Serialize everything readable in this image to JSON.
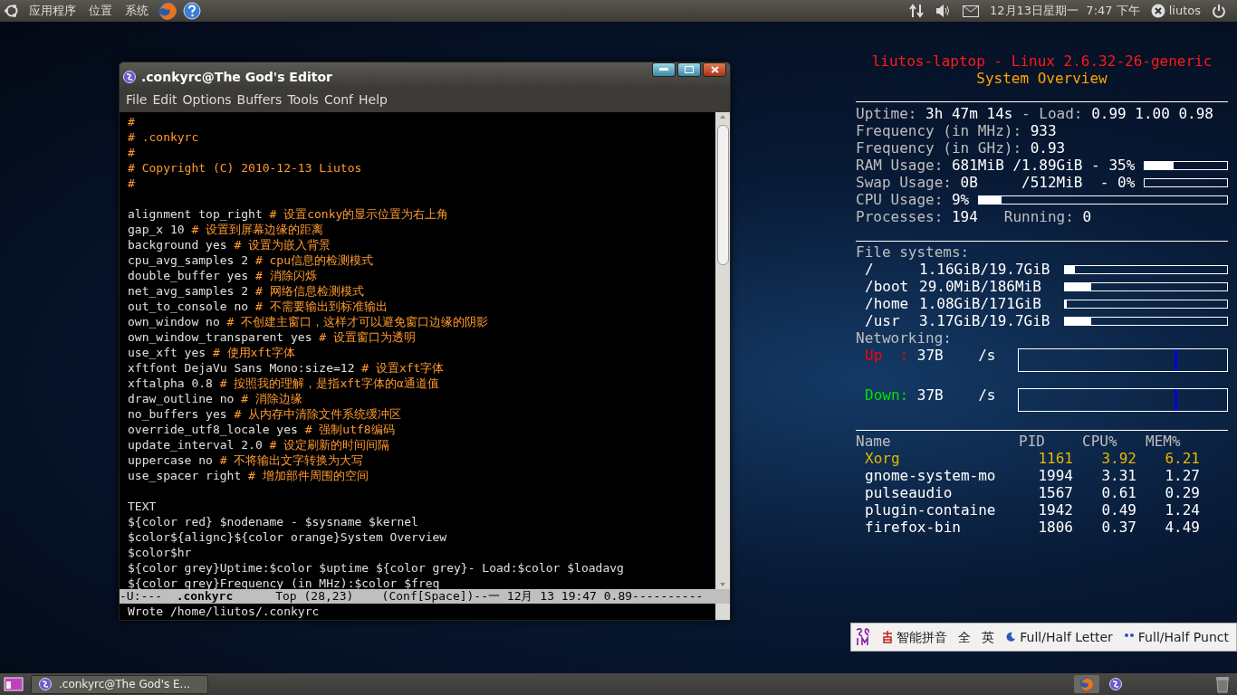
{
  "top_panel": {
    "menus": [
      {
        "label": "应用程序"
      },
      {
        "label": "位置"
      },
      {
        "label": "系统"
      }
    ],
    "clock": "12月13日星期一  7:47 下午",
    "user": "liutos"
  },
  "editor": {
    "title": ".conkyrc@The God's Editor",
    "menu": [
      {
        "label": "File"
      },
      {
        "label": "Edit"
      },
      {
        "label": "Options"
      },
      {
        "label": "Buffers"
      },
      {
        "label": "Tools"
      },
      {
        "label": "Conf"
      },
      {
        "label": "Help"
      }
    ],
    "lines": [
      {
        "kind": "comment",
        "text": "#"
      },
      {
        "kind": "comment",
        "text": "# .conkyrc"
      },
      {
        "kind": "comment",
        "text": "#"
      },
      {
        "kind": "comment",
        "text": "# Copyright (C) 2010-12-13 Liutos"
      },
      {
        "kind": "comment",
        "text": "#"
      },
      {
        "kind": "blank"
      },
      {
        "kind": "setting",
        "code": "alignment top_right",
        "comment": "# 设置conky的显示位置为右上角"
      },
      {
        "kind": "setting",
        "code": "gap_x 10",
        "comment": "# 设置到屏幕边缘的距离"
      },
      {
        "kind": "setting",
        "code": "background yes",
        "comment": "# 设置为嵌入背景"
      },
      {
        "kind": "setting",
        "code": "cpu_avg_samples 2",
        "comment": "# cpu信息的检测模式"
      },
      {
        "kind": "setting",
        "code": "double_buffer yes",
        "comment": "# 消除闪烁"
      },
      {
        "kind": "setting",
        "code": "net_avg_samples 2",
        "comment": "# 网络信息检测模式"
      },
      {
        "kind": "setting",
        "code": "out_to_console no",
        "comment": "# 不需要输出到标准输出"
      },
      {
        "kind": "setting",
        "code": "own_window no",
        "comment": "# 不创建主窗口，这样才可以避免窗口边缘的阴影"
      },
      {
        "kind": "setting",
        "code": "own_window_transparent yes",
        "comment": "# 设置窗口为透明"
      },
      {
        "kind": "setting",
        "code": "use_xft yes",
        "comment": "# 使用xft字体"
      },
      {
        "kind": "setting",
        "code": "xftfont DejaVu Sans Mono:size=12",
        "comment": "# 设置xft字体"
      },
      {
        "kind": "setting",
        "code": "xftalpha 0.8",
        "comment": "# 按照我的理解，是指xft字体的α通道值"
      },
      {
        "kind": "setting",
        "code": "draw_outline no",
        "comment": "# 消除边缘"
      },
      {
        "kind": "setting",
        "code": "no_buffers yes",
        "comment": "# 从内存中清除文件系统缓冲区"
      },
      {
        "kind": "setting",
        "code": "override_utf8_locale yes",
        "comment": "# 强制utf8编码"
      },
      {
        "kind": "setting",
        "code": "update_interval 2.0",
        "comment": "# 设定刷新的时间间隔"
      },
      {
        "kind": "setting",
        "code": "uppercase no",
        "comment": "# 不将输出文字转换为大写"
      },
      {
        "kind": "setting",
        "code": "use_spacer right",
        "comment": "# 增加部件周围的空间"
      },
      {
        "kind": "blank"
      },
      {
        "kind": "plain",
        "text": "TEXT"
      },
      {
        "kind": "plain",
        "text": "${color red} $nodename - $sysname $kernel"
      },
      {
        "kind": "plain",
        "text": "$color${alignc}${color orange}System Overview"
      },
      {
        "kind": "plain",
        "text": "$color$hr"
      },
      {
        "kind": "plain",
        "text": "${color grey}Uptime:$color $uptime ${color grey}- Load:$color $loadavg"
      },
      {
        "kind": "plain",
        "text": "${color grey}Frequency (in MHz):$color $freq"
      }
    ],
    "modeline": {
      "state": "-U:---",
      "buffer": ".conkyrc",
      "rest": "Top (28,23)    (Conf[Space])--一 12月 13 19:47 0.89----------"
    },
    "minibuffer": "Wrote /home/liutos/.conkyrc"
  },
  "conky": {
    "title": "liutos-laptop - Linux 2.6.32-26-generic",
    "subtitle": "System Overview",
    "stats": [
      {
        "parts": [
          {
            "text": "Uptime:",
            "kind": "label"
          },
          {
            "text": "3h 47m 14s",
            "kind": "value"
          },
          {
            "text": "- Load:",
            "kind": "label"
          },
          {
            "text": "0.99 1.00 0.98",
            "kind": "value"
          }
        ]
      },
      {
        "parts": [
          {
            "text": "Frequency (in MHz):",
            "kind": "label"
          },
          {
            "text": "933",
            "kind": "value"
          }
        ]
      },
      {
        "parts": [
          {
            "text": "Frequency (in GHz):",
            "kind": "label"
          },
          {
            "text": "0.93",
            "kind": "value"
          }
        ]
      },
      {
        "parts": [
          {
            "text": "RAM Usage:",
            "kind": "label"
          },
          {
            "text": "681MiB /1.89GiB",
            "kind": "value"
          },
          {
            "text": "- 35%",
            "kind": "value"
          }
        ],
        "meter": true,
        "level": 0.35
      },
      {
        "parts": [
          {
            "text": "Swap Usage:",
            "kind": "label"
          },
          {
            "text": "0B     /512MiB ",
            "kind": "value"
          },
          {
            "text": "- 0%",
            "kind": "value"
          }
        ],
        "meter": true
      },
      {
        "parts": [
          {
            "text": "CPU Usage:",
            "kind": "label"
          },
          {
            "text": "9%",
            "kind": "value"
          }
        ],
        "meter": true,
        "level": 0.09
      },
      {
        "parts": [
          {
            "text": "Processes:",
            "kind": "label"
          },
          {
            "text": "194  ",
            "kind": "value"
          },
          {
            "text": "Running:",
            "kind": "label"
          },
          {
            "text": "0",
            "kind": "value"
          }
        ]
      }
    ],
    "fs_heading": "File systems:",
    "filesystems": [
      {
        "mount": "/",
        "usage": "1.16GiB/19.7GiB",
        "level": 0.06
      },
      {
        "mount": "/boot",
        "usage": "29.0MiB/186MiB",
        "level": 0.16
      },
      {
        "mount": "/home",
        "usage": "1.08GiB/171GiB",
        "level": 0.01
      },
      {
        "mount": "/usr",
        "usage": "3.17GiB/19.7GiB",
        "level": 0.16
      }
    ],
    "net_heading": "Networking:",
    "network": [
      {
        "label": "Up  :",
        "value": "37B",
        "unit": "/s",
        "color": "#ff0000"
      },
      {
        "label": "Down:",
        "value": "37B",
        "unit": "/s",
        "color": "#00e000"
      }
    ],
    "columns": [
      "Name",
      "PID",
      "CPU%",
      "MEM%"
    ],
    "processes": [
      {
        "cells": [
          "Xorg",
          "1161",
          "3.92",
          "6.21"
        ],
        "highlighted": true
      },
      {
        "cells": [
          "gnome-system-mo",
          "1994",
          "3.31",
          "1.27"
        ],
        "highlighted": false
      },
      {
        "cells": [
          "pulseaudio",
          "1567",
          "0.61",
          "0.29"
        ],
        "highlighted": false
      },
      {
        "cells": [
          "plugin-containe",
          "1942",
          "0.49",
          "1.24"
        ],
        "highlighted": false
      },
      {
        "cells": [
          "firefox-bin",
          "1806",
          "0.37",
          "4.49"
        ],
        "highlighted": false
      }
    ]
  },
  "ime_bar": {
    "mode": "智能拼音",
    "width": "全",
    "language": "英",
    "letter": "Full/Half Letter",
    "punct": "Full/Half Punct"
  },
  "bottom_panel": {
    "task": ".conkyrc@The God's E..."
  }
}
